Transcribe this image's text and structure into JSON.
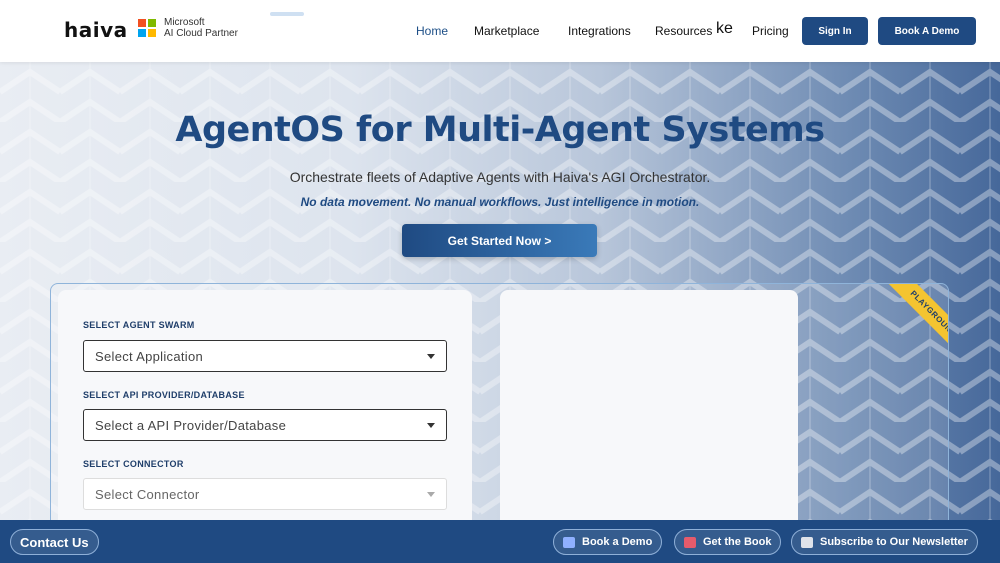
{
  "nav": {
    "logo": "haiva",
    "partner_line1": "Microsoft",
    "partner_line2": "AI Cloud Partner",
    "links": [
      "Home",
      "Marketplace",
      "Integrations",
      "Resources",
      "Pricing"
    ],
    "ke_text": "ke",
    "sign_in": "Sign In",
    "book_demo": "Book A Demo",
    "ms_colors": [
      "#f25022",
      "#7fba00",
      "#00a4ef",
      "#ffb900"
    ]
  },
  "hero": {
    "title": "AgentOS for Multi-Agent Systems",
    "subtitle": "Orchestrate fleets of Adaptive Agents with Haiva's AGI Orchestrator.",
    "tagline": "No data movement. No manual workflows. Just intelligence in motion.",
    "cta": "Get Started Now >"
  },
  "playground": {
    "ribbon": "PLAYGROUND",
    "fields": [
      {
        "label": "SELECT AGENT SWARM",
        "placeholder": "Select Application"
      },
      {
        "label": "SELECT API PROVIDER/DATABASE",
        "placeholder": "Select a API Provider/Database"
      },
      {
        "label": "SELECT CONNECTOR",
        "placeholder": "Select Connector"
      }
    ]
  },
  "footer": {
    "contact": "Contact Us",
    "book_demo": "Book a Demo",
    "get_book": "Get the Book",
    "newsletter": "Subscribe to Our Newsletter"
  },
  "colors": {
    "brand": "#1f4a82",
    "ribbon": "#f4c430"
  }
}
